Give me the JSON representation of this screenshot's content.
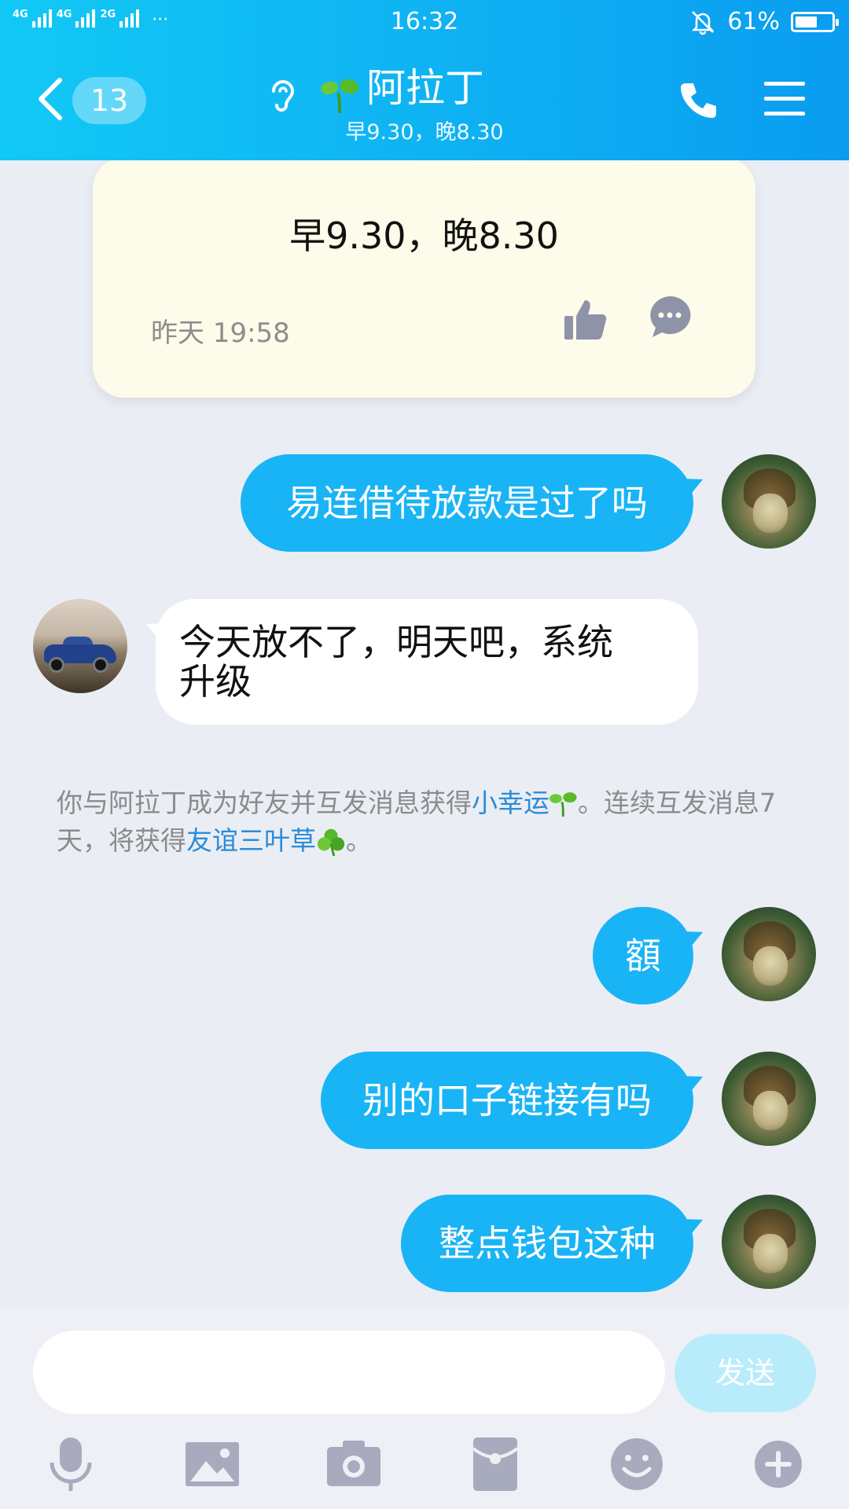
{
  "status_bar": {
    "network_labels": [
      "4G",
      "4G",
      "2G"
    ],
    "more": "···",
    "time": "16:32",
    "battery_percent": "61%",
    "battery_level": 0.61
  },
  "header": {
    "unread_count": "13",
    "contact_name": "阿拉丁",
    "contact_status": "早9.30，晚8.30"
  },
  "pinned": {
    "text": "早9.30，晚8.30",
    "time": "昨天 19:58"
  },
  "messages": [
    {
      "from": "me",
      "text": "易连借待放款是过了吗"
    },
    {
      "from": "friend",
      "text_line1": "今天放不了，明天吧，系统",
      "text_line2": "升级"
    },
    {
      "from": "me",
      "text": "額"
    },
    {
      "from": "me",
      "text": "别的口子链接有吗"
    },
    {
      "from": "me",
      "text": "整点钱包这种"
    }
  ],
  "system_message": {
    "part1": "你与阿拉丁成为好友并互发消息获得",
    "link1": "小幸运",
    "part2": "。连续互发消息7天，将获得",
    "link2": "友谊三叶草",
    "part3": "。"
  },
  "input": {
    "placeholder": "",
    "send_label": "发送"
  },
  "colors": {
    "header_gradient_start": "#12c8f5",
    "header_gradient_end": "#0a9cf0",
    "outgoing_bubble": "#19b4f5",
    "incoming_bubble": "#ffffff",
    "pinned_card": "#fdfbe9",
    "link": "#2a8cd9",
    "send_button_disabled": "#b9ecfb",
    "toolbar_icon": "#a7abbd"
  },
  "toolbar_icons": [
    "microphone-icon",
    "image-icon",
    "camera-icon",
    "red-packet-icon",
    "emoji-icon",
    "plus-icon"
  ]
}
